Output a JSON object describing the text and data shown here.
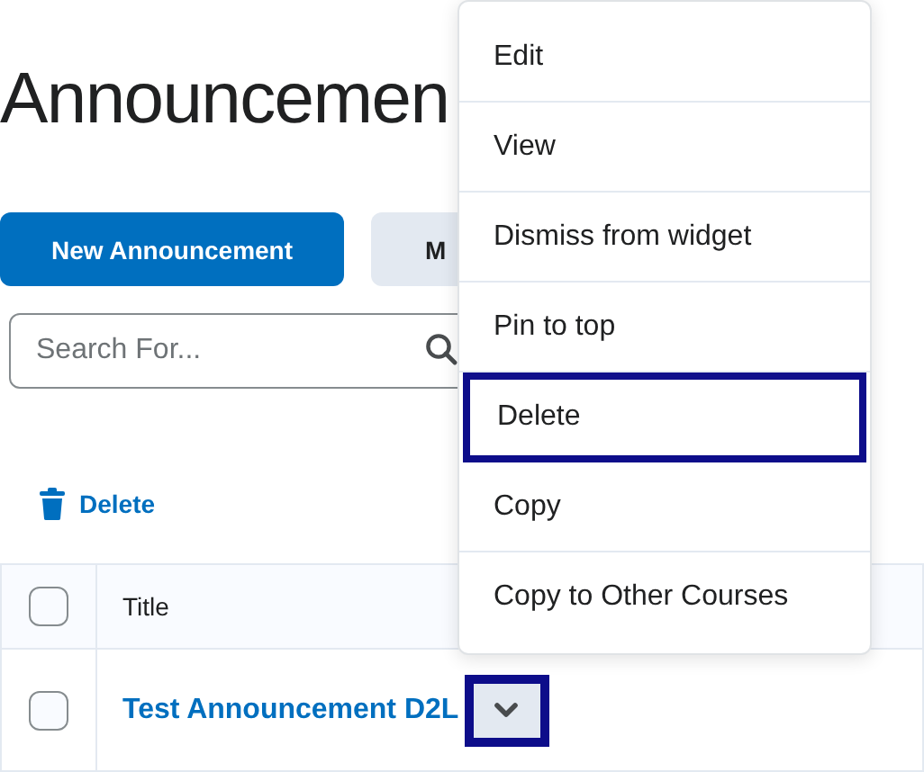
{
  "heading": "Announcemen",
  "buttons": [
    {
      "label": "New Announcement",
      "kind": "primary"
    },
    {
      "label": "M",
      "kind": "secondary"
    }
  ],
  "search": {
    "placeholder": "Search For..."
  },
  "bulk_action": {
    "label": "Delete"
  },
  "table": {
    "columns": [
      "Title"
    ],
    "header_checked": false,
    "rows": [
      {
        "title": "Test Announcement D2L",
        "checked": false,
        "menu_button_focused": true
      }
    ]
  },
  "context_menu": {
    "items": [
      {
        "label": "Edit",
        "selected": false
      },
      {
        "label": "View",
        "selected": false
      },
      {
        "label": "Dismiss from widget",
        "selected": false
      },
      {
        "label": "Pin to top",
        "selected": false
      },
      {
        "label": "Delete",
        "selected": true
      },
      {
        "label": "Copy",
        "selected": false
      },
      {
        "label": "Copy to Other Courses",
        "selected": false
      }
    ]
  }
}
